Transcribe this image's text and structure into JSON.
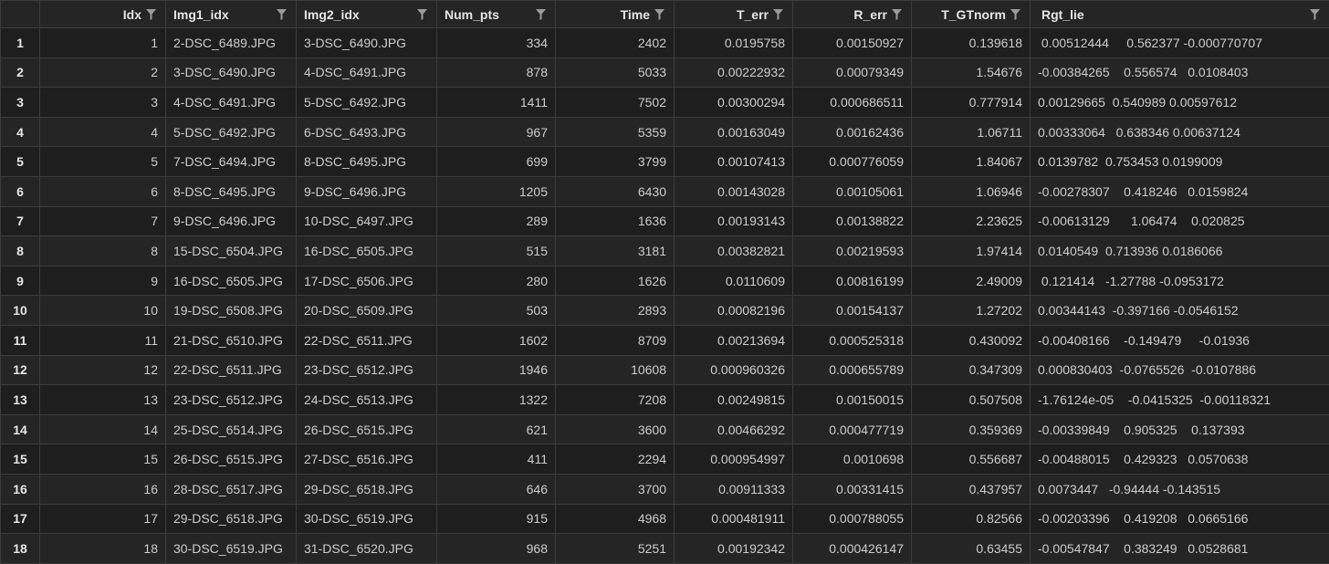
{
  "table": {
    "columns": [
      {
        "key": "idx",
        "label": "Idx"
      },
      {
        "key": "img1",
        "label": "Img1_idx"
      },
      {
        "key": "img2",
        "label": "Img2_idx"
      },
      {
        "key": "num_pts",
        "label": "Num_pts"
      },
      {
        "key": "time",
        "label": "Time"
      },
      {
        "key": "t_err",
        "label": "T_err"
      },
      {
        "key": "r_err",
        "label": "R_err"
      },
      {
        "key": "t_gtnorm",
        "label": "T_GTnorm"
      },
      {
        "key": "rgt_lie",
        "label": "Rgt_lie"
      }
    ],
    "rows": [
      {
        "row": "1",
        "idx": "1",
        "img1": "2-DSC_6489.JPG",
        "img2": "3-DSC_6490.JPG",
        "num_pts": "334",
        "time": "2402",
        "t_err": "0.0195758",
        "r_err": "0.00150927",
        "t_gtnorm": "0.139618",
        "rgt_lie": " 0.00512444     0.562377 -0.000770707"
      },
      {
        "row": "2",
        "idx": "2",
        "img1": "3-DSC_6490.JPG",
        "img2": "4-DSC_6491.JPG",
        "num_pts": "878",
        "time": "5033",
        "t_err": "0.00222932",
        "r_err": "0.00079349",
        "t_gtnorm": "1.54676",
        "rgt_lie": "-0.00384265    0.556574   0.0108403"
      },
      {
        "row": "3",
        "idx": "3",
        "img1": "4-DSC_6491.JPG",
        "img2": "5-DSC_6492.JPG",
        "num_pts": "1411",
        "time": "7502",
        "t_err": "0.00300294",
        "r_err": "0.000686511",
        "t_gtnorm": "0.777914",
        "rgt_lie": "0.00129665  0.540989 0.00597612"
      },
      {
        "row": "4",
        "idx": "4",
        "img1": "5-DSC_6492.JPG",
        "img2": "6-DSC_6493.JPG",
        "num_pts": "967",
        "time": "5359",
        "t_err": "0.00163049",
        "r_err": "0.00162436",
        "t_gtnorm": "1.06711",
        "rgt_lie": "0.00333064   0.638346 0.00637124"
      },
      {
        "row": "5",
        "idx": "5",
        "img1": "7-DSC_6494.JPG",
        "img2": "8-DSC_6495.JPG",
        "num_pts": "699",
        "time": "3799",
        "t_err": "0.00107413",
        "r_err": "0.000776059",
        "t_gtnorm": "1.84067",
        "rgt_lie": "0.0139782  0.753453 0.0199009"
      },
      {
        "row": "6",
        "idx": "6",
        "img1": "8-DSC_6495.JPG",
        "img2": "9-DSC_6496.JPG",
        "num_pts": "1205",
        "time": "6430",
        "t_err": "0.00143028",
        "r_err": "0.00105061",
        "t_gtnorm": "1.06946",
        "rgt_lie": "-0.00278307    0.418246   0.0159824"
      },
      {
        "row": "7",
        "idx": "7",
        "img1": "9-DSC_6496.JPG",
        "img2": "10-DSC_6497.JPG",
        "num_pts": "289",
        "time": "1636",
        "t_err": "0.00193143",
        "r_err": "0.00138822",
        "t_gtnorm": "2.23625",
        "rgt_lie": "-0.00613129      1.06474    0.020825"
      },
      {
        "row": "8",
        "idx": "8",
        "img1": "15-DSC_6504.JPG",
        "img2": "16-DSC_6505.JPG",
        "num_pts": "515",
        "time": "3181",
        "t_err": "0.00382821",
        "r_err": "0.00219593",
        "t_gtnorm": "1.97414",
        "rgt_lie": "0.0140549  0.713936 0.0186066"
      },
      {
        "row": "9",
        "idx": "9",
        "img1": "16-DSC_6505.JPG",
        "img2": "17-DSC_6506.JPG",
        "num_pts": "280",
        "time": "1626",
        "t_err": "0.0110609",
        "r_err": "0.00816199",
        "t_gtnorm": "2.49009",
        "rgt_lie": " 0.121414   -1.27788 -0.0953172"
      },
      {
        "row": "10",
        "idx": "10",
        "img1": "19-DSC_6508.JPG",
        "img2": "20-DSC_6509.JPG",
        "num_pts": "503",
        "time": "2893",
        "t_err": "0.00082196",
        "r_err": "0.00154137",
        "t_gtnorm": "1.27202",
        "rgt_lie": "0.00344143  -0.397166 -0.0546152"
      },
      {
        "row": "11",
        "idx": "11",
        "img1": "21-DSC_6510.JPG",
        "img2": "22-DSC_6511.JPG",
        "num_pts": "1602",
        "time": "8709",
        "t_err": "0.00213694",
        "r_err": "0.000525318",
        "t_gtnorm": "0.430092",
        "rgt_lie": "-0.00408166    -0.149479     -0.01936"
      },
      {
        "row": "12",
        "idx": "12",
        "img1": "22-DSC_6511.JPG",
        "img2": "23-DSC_6512.JPG",
        "num_pts": "1946",
        "time": "10608",
        "t_err": "0.000960326",
        "r_err": "0.000655789",
        "t_gtnorm": "0.347309",
        "rgt_lie": "0.000830403  -0.0765526  -0.0107886"
      },
      {
        "row": "13",
        "idx": "13",
        "img1": "23-DSC_6512.JPG",
        "img2": "24-DSC_6513.JPG",
        "num_pts": "1322",
        "time": "7208",
        "t_err": "0.00249815",
        "r_err": "0.00150015",
        "t_gtnorm": "0.507508",
        "rgt_lie": "-1.76124e-05    -0.0415325  -0.00118321"
      },
      {
        "row": "14",
        "idx": "14",
        "img1": "25-DSC_6514.JPG",
        "img2": "26-DSC_6515.JPG",
        "num_pts": "621",
        "time": "3600",
        "t_err": "0.00466292",
        "r_err": "0.000477719",
        "t_gtnorm": "0.359369",
        "rgt_lie": "-0.00339849    0.905325    0.137393"
      },
      {
        "row": "15",
        "idx": "15",
        "img1": "26-DSC_6515.JPG",
        "img2": "27-DSC_6516.JPG",
        "num_pts": "411",
        "time": "2294",
        "t_err": "0.000954997",
        "r_err": "0.0010698",
        "t_gtnorm": "0.556687",
        "rgt_lie": "-0.00488015    0.429323   0.0570638"
      },
      {
        "row": "16",
        "idx": "16",
        "img1": "28-DSC_6517.JPG",
        "img2": "29-DSC_6518.JPG",
        "num_pts": "646",
        "time": "3700",
        "t_err": "0.00911333",
        "r_err": "0.00331415",
        "t_gtnorm": "0.437957",
        "rgt_lie": "0.0073447   -0.94444 -0.143515"
      },
      {
        "row": "17",
        "idx": "17",
        "img1": "29-DSC_6518.JPG",
        "img2": "30-DSC_6519.JPG",
        "num_pts": "915",
        "time": "4968",
        "t_err": "0.000481911",
        "r_err": "0.000788055",
        "t_gtnorm": "0.82566",
        "rgt_lie": "-0.00203396    0.419208   0.0665166"
      },
      {
        "row": "18",
        "idx": "18",
        "img1": "30-DSC_6519.JPG",
        "img2": "31-DSC_6520.JPG",
        "num_pts": "968",
        "time": "5251",
        "t_err": "0.00192342",
        "r_err": "0.000426147",
        "t_gtnorm": "0.63455",
        "rgt_lie": "-0.00547847    0.383249   0.0528681"
      }
    ]
  }
}
